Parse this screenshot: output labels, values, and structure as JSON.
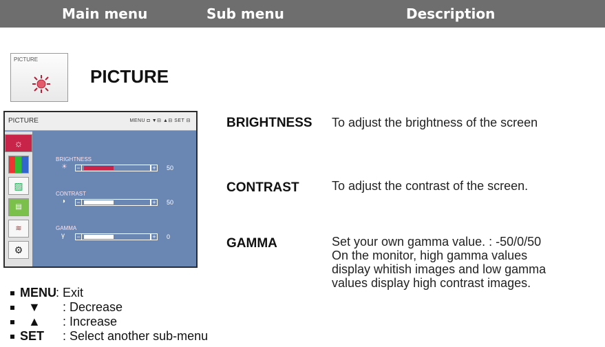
{
  "header": {
    "main_menu": "Main menu",
    "sub_menu": "Sub menu",
    "description": "Description"
  },
  "picture_section": {
    "icon_label": "PICTURE",
    "title": "PICTURE"
  },
  "osd": {
    "title": "PICTURE",
    "keys_hint": "MENU ◘  ▼⊟  ▲⊟  SET ⊟",
    "tabs": [
      "picture-icon",
      "color-icon",
      "position-icon",
      "tracking-icon",
      "setup-icon",
      "gear-icon"
    ],
    "items": [
      {
        "label": "BRIGHTNESS",
        "icon": "☀",
        "value": "50",
        "level": 0.5,
        "fill_color": "#c8244a"
      },
      {
        "label": "CONTRAST",
        "icon": "◑",
        "value": "50",
        "level": 0.5,
        "fill_color": "#ffffff"
      },
      {
        "label": "GAMMA",
        "icon": "γ",
        "value": "0",
        "level": 0.5,
        "fill_color": "#ffffff"
      }
    ]
  },
  "descriptions": [
    {
      "name": "BRIGHTNESS",
      "text": "To adjust the brightness of the screen"
    },
    {
      "name": "CONTRAST",
      "text": "To adjust the contrast of the screen."
    },
    {
      "name": "GAMMA",
      "lines": [
        "Set your own gamma value. : -50/0/50",
        "On the monitor, high gamma values",
        "display whitish images and low gamma",
        "values display high contrast images."
      ]
    }
  ],
  "legend": [
    {
      "key": "MENU",
      "desc": ": Exit"
    },
    {
      "key": "▼",
      "desc": ": Decrease"
    },
    {
      "key": "▲",
      "desc": ": Increase"
    },
    {
      "key": "SET",
      "desc": ": Select another sub-menu"
    }
  ],
  "colors": {
    "header_bg": "#6e6e6e",
    "osd_bg": "#6a87b4",
    "accent": "#c8244a"
  }
}
